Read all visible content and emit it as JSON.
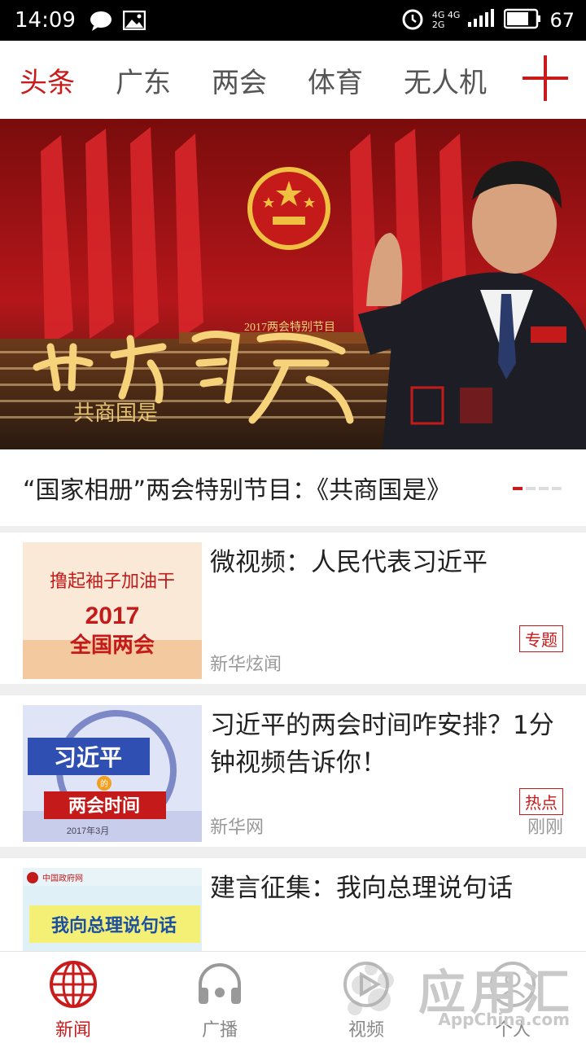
{
  "status": {
    "time": "14:09",
    "signal_top": "4G 4G",
    "signal_bottom": "2G",
    "battery": "67"
  },
  "tabs": [
    "头条",
    "广东",
    "两会",
    "体育",
    "无人机"
  ],
  "banner": {
    "calligraphy": "共商国是",
    "subtitle": "2017两会特别节目",
    "caption": "“国家相册”两会特别节目：《共商国是》"
  },
  "news": [
    {
      "title": "微视频：人民代表习近平",
      "source": "新华炫闻",
      "tag": "专题",
      "time": "",
      "thumb_text": {
        "line1": "撸起袖子加油干",
        "line2": "2017",
        "line3": "全国两会"
      }
    },
    {
      "title": "习近平的两会时间咋安排？1分钟视频告诉你！",
      "source": "新华网",
      "tag": "热点",
      "time": "刚刚",
      "thumb_text": {
        "line1": "习近平",
        "line2": "的",
        "line3": "两会时间",
        "line4": "2017年3月"
      }
    },
    {
      "title": "建言征集：我向总理说句话",
      "source": "",
      "tag": "",
      "time": "",
      "thumb_text": {
        "line1": "中国政府网",
        "line2": "我向总理说句话"
      }
    }
  ],
  "bottom_nav": [
    {
      "label": "新闻",
      "icon": "globe-icon"
    },
    {
      "label": "广播",
      "icon": "headphones-icon"
    },
    {
      "label": "视频",
      "icon": "play-icon"
    },
    {
      "label": "个人",
      "icon": "user-icon"
    }
  ],
  "watermark": {
    "text": "应用汇",
    "sub": "AppChina.com"
  },
  "colors": {
    "accent": "#c91b1b",
    "banner_red": "#b5161a",
    "gold": "#f0c040"
  }
}
